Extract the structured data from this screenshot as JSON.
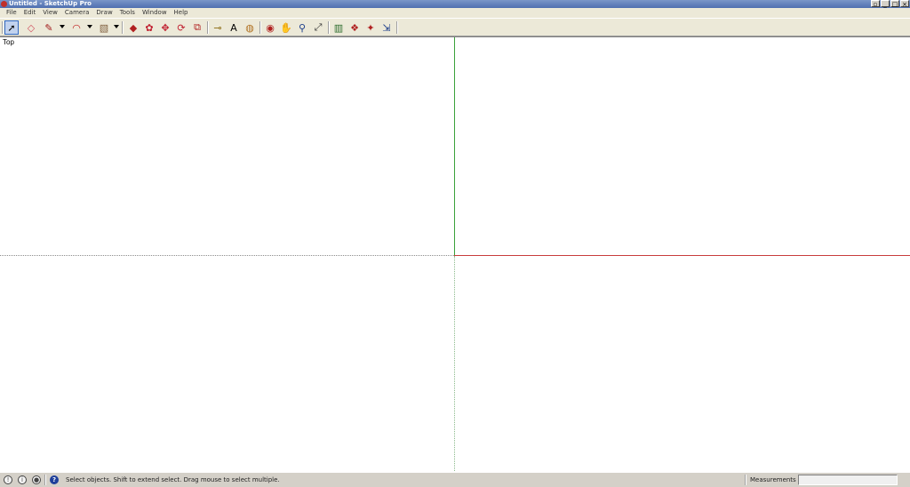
{
  "window": {
    "title": "Untitled - SketchUp Pro"
  },
  "menu": [
    "File",
    "Edit",
    "View",
    "Camera",
    "Draw",
    "Tools",
    "Window",
    "Help"
  ],
  "toolbar": {
    "tools": [
      {
        "name": "select-tool-icon",
        "glyph": "➚",
        "color": "#000000"
      },
      {
        "name": "eraser-tool-icon",
        "glyph": "◇",
        "color": "#d05060"
      },
      {
        "name": "line-tool-icon",
        "glyph": "✎",
        "color": "#a01818"
      },
      {
        "name": "arc-tool-icon",
        "glyph": "◠",
        "color": "#c02020"
      },
      {
        "name": "rectangle-tool-icon",
        "glyph": "▧",
        "color": "#806040"
      },
      {
        "name": "push-pull-tool-icon",
        "glyph": "◆",
        "color": "#b02020"
      },
      {
        "name": "follow-me-tool-icon",
        "glyph": "✿",
        "color": "#c02030"
      },
      {
        "name": "move-tool-icon",
        "glyph": "✥",
        "color": "#c02030"
      },
      {
        "name": "rotate-tool-icon",
        "glyph": "⟳",
        "color": "#c02030"
      },
      {
        "name": "scale-tool-icon",
        "glyph": "⧉",
        "color": "#b02020"
      },
      {
        "name": "tape-measure-tool-icon",
        "glyph": "⊸",
        "color": "#8a6a10"
      },
      {
        "name": "text-tool-icon",
        "glyph": "A",
        "color": "#000000"
      },
      {
        "name": "paint-bucket-tool-icon",
        "glyph": "◍",
        "color": "#b07020"
      },
      {
        "name": "orbit-tool-icon",
        "glyph": "◉",
        "color": "#b02020"
      },
      {
        "name": "pan-tool-icon",
        "glyph": "✋",
        "color": "#333333"
      },
      {
        "name": "zoom-tool-icon",
        "glyph": "⚲",
        "color": "#1a3c8a"
      },
      {
        "name": "zoom-extents-tool-icon",
        "glyph": "⤢",
        "color": "#333333"
      },
      {
        "name": "components-icon",
        "glyph": "▥",
        "color": "#2a6a2a"
      },
      {
        "name": "warehouse-icon",
        "glyph": "❖",
        "color": "#b02020"
      },
      {
        "name": "share-model-icon",
        "glyph": "✦",
        "color": "#b02020"
      },
      {
        "name": "extension-icon",
        "glyph": "⇲",
        "color": "#1a3c8a"
      }
    ]
  },
  "viewport": {
    "view_label": "Top"
  },
  "status": {
    "icons": [
      "geolocation-icon",
      "credit-icon",
      "user-icon",
      "help-icon"
    ],
    "message": "Select objects. Shift to extend select. Drag mouse to select multiple.",
    "measurements_label": "Measurements",
    "measurements_value": ""
  }
}
